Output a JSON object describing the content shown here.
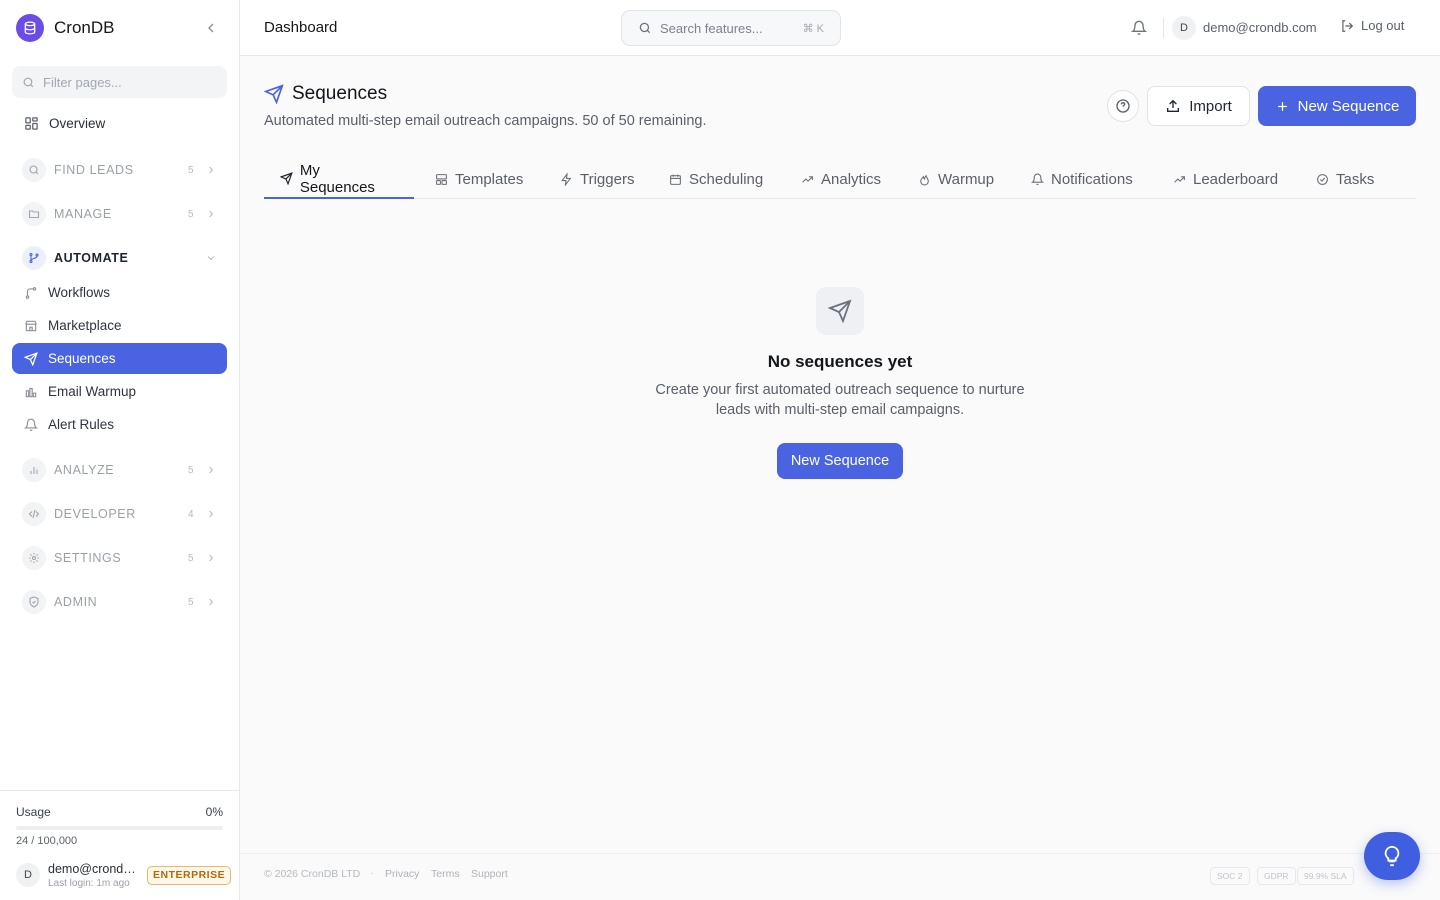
{
  "app": {
    "name": "CronDB"
  },
  "sidebar": {
    "filter_placeholder": "Filter pages...",
    "overview_label": "Overview",
    "groups": [
      {
        "label": "FIND LEADS",
        "count": "5",
        "icon": "search-icon"
      },
      {
        "label": "MANAGE",
        "count": "5",
        "icon": "folder-icon"
      },
      {
        "label": "AUTOMATE",
        "icon": "branch-icon",
        "expanded": true
      },
      {
        "label": "ANALYZE",
        "count": "5",
        "icon": "bar-chart-icon"
      },
      {
        "label": "DEVELOPER",
        "count": "4",
        "icon": "code-icon"
      },
      {
        "label": "SETTINGS",
        "count": "5",
        "icon": "gear-icon"
      },
      {
        "label": "ADMIN",
        "count": "5",
        "icon": "shield-icon"
      }
    ],
    "automate_items": [
      {
        "label": "Workflows",
        "icon": "workflow-icon"
      },
      {
        "label": "Marketplace",
        "icon": "store-icon"
      },
      {
        "label": "Sequences",
        "icon": "send-icon",
        "active": true
      },
      {
        "label": "Email Warmup",
        "icon": "warmup-icon"
      },
      {
        "label": "Alert Rules",
        "icon": "bell-icon"
      }
    ],
    "usage": {
      "label": "Usage",
      "percent_text": "0%",
      "fraction": 0.0,
      "count_text": "24 / 100,000"
    },
    "user": {
      "avatar_initial": "D",
      "email": "demo@crondb.com",
      "last_login": "Last login: 1m ago",
      "plan_badge": "ENTERPRISE"
    }
  },
  "header": {
    "breadcrumb": "Dashboard",
    "search_placeholder": "Search features...",
    "search_shortcut": "⌘ K",
    "avatar_initial": "D",
    "user_email": "demo@crondb.com",
    "logout_label": "Log out"
  },
  "page": {
    "title": "Sequences",
    "subtitle": "Automated multi-step email outreach campaigns. 50 of 50 remaining.",
    "import_label": "Import",
    "new_label": "New Sequence"
  },
  "tabs": [
    {
      "label": "My Sequences",
      "icon": "send-icon",
      "active": true
    },
    {
      "label": "Templates",
      "icon": "template-icon"
    },
    {
      "label": "Triggers",
      "icon": "lightning-icon"
    },
    {
      "label": "Scheduling",
      "icon": "calendar-icon"
    },
    {
      "label": "Analytics",
      "icon": "trend-icon"
    },
    {
      "label": "Warmup",
      "icon": "flame-icon"
    },
    {
      "label": "Notifications",
      "icon": "bell-icon"
    },
    {
      "label": "Leaderboard",
      "icon": "trend-icon"
    },
    {
      "label": "Tasks",
      "icon": "check-circle-icon"
    }
  ],
  "empty_state": {
    "title": "No sequences yet",
    "description": "Create your first automated outreach sequence to nurture leads with multi-step email campaigns.",
    "button_label": "New Sequence"
  },
  "footer": {
    "copyright": "© 2026 CronDB LTD",
    "separator": "·",
    "links": [
      "Privacy",
      "Terms",
      "Support"
    ],
    "badges": [
      "SOC 2",
      "GDPR",
      "99.9% SLA"
    ]
  },
  "colors": {
    "accent": "#4a63e0",
    "brand": "#6b4de6",
    "badge": "#b26a0c"
  }
}
